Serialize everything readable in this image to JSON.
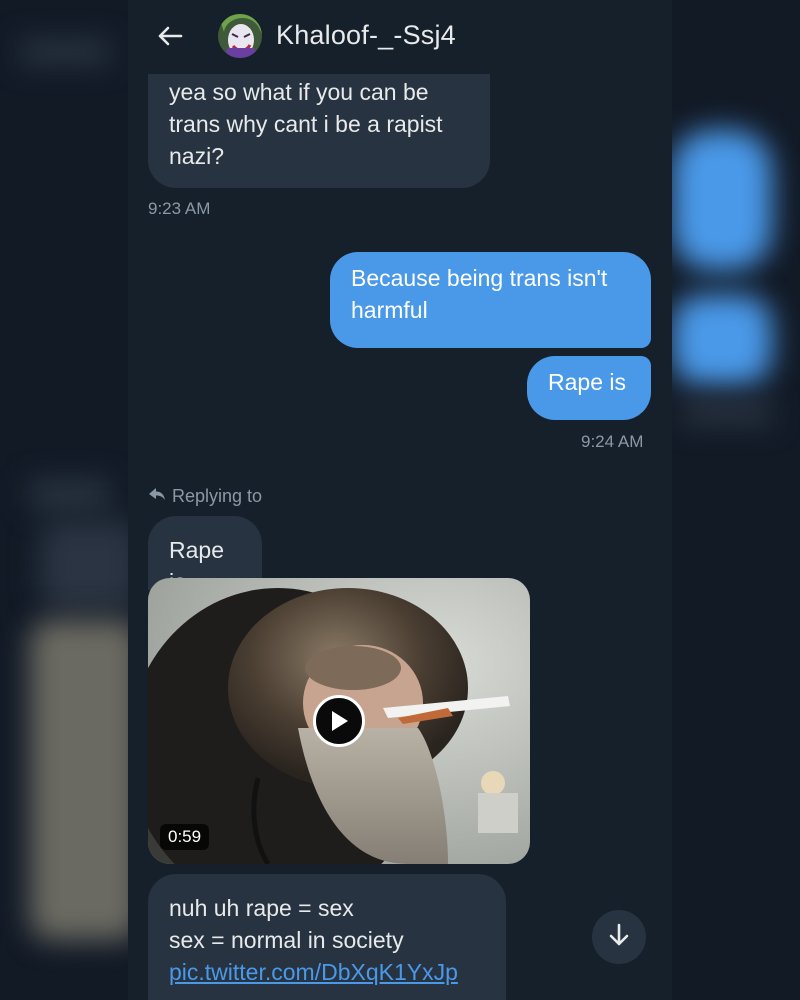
{
  "header": {
    "contact_name": "Khaloof-_-Ssj4",
    "back_icon": "arrow-left-icon",
    "avatar": "joker-avatar"
  },
  "messages": [
    {
      "direction": "in",
      "text_lines": [
        "yea so what if you can be",
        "trans why cant i be a rapist",
        "nazi?"
      ]
    },
    {
      "direction": "in",
      "timestamp": "9:23 AM"
    },
    {
      "direction": "out",
      "text_lines": [
        "Because being trans isn't",
        "harmful"
      ]
    },
    {
      "direction": "out",
      "text": "Rape is",
      "timestamp": "9:24 AM"
    }
  ],
  "reply": {
    "label": "Replying to",
    "quoted_text": "Rape is",
    "icon": "reply-arrow-icon"
  },
  "media": {
    "type": "video",
    "duration": "0:59",
    "icon": "play-icon"
  },
  "last_message": {
    "line1": "nuh uh rape = sex",
    "line2": "sex = normal in society",
    "link": "pic.twitter.com/DbXqK1YxJp"
  },
  "scroll_button_icon": "arrow-down-icon",
  "colors": {
    "background": "#15202b",
    "incoming_bubble": "#273340",
    "outgoing_bubble": "#4a99e9",
    "timestamp": "#8b98a5",
    "link": "#4a99e9"
  }
}
